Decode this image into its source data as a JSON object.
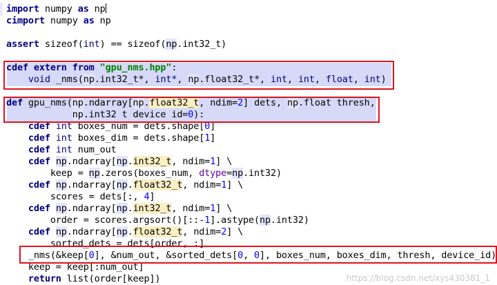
{
  "editor": {
    "language": "cython",
    "lines": [
      [
        [
          "kw",
          "import"
        ],
        [
          "txt",
          " numpy "
        ],
        [
          "kw",
          "as"
        ],
        [
          "txt",
          " np"
        ]
      ],
      [
        [
          "kw",
          "cimport"
        ],
        [
          "txt",
          " numpy "
        ],
        [
          "kw",
          "as"
        ],
        [
          "txt",
          " np"
        ]
      ],
      [],
      [
        [
          "kw",
          "assert"
        ],
        [
          "txt",
          " sizeof("
        ],
        [
          "ty",
          "int"
        ],
        [
          "txt",
          ") == sizeof("
        ],
        [
          "mod",
          "np"
        ],
        [
          "txt",
          ".int32_t)"
        ]
      ],
      [],
      [
        [
          "kw",
          "cdef extern from"
        ],
        [
          "txt",
          " "
        ],
        [
          "str",
          "\"gpu_nms.hpp\""
        ],
        [
          "txt",
          ":"
        ]
      ],
      [
        [
          "txt",
          "    "
        ],
        [
          "ty",
          "void"
        ],
        [
          "txt",
          " _nms("
        ],
        [
          "mod",
          "np"
        ],
        [
          "txt",
          "."
        ],
        [
          "txt",
          "int32_t*"
        ],
        [
          "txt",
          ", "
        ],
        [
          "ty",
          "int*"
        ],
        [
          "txt",
          ", "
        ],
        [
          "mod",
          "np"
        ],
        [
          "txt",
          ".float32_t*, "
        ],
        [
          "ty",
          "int"
        ],
        [
          "txt",
          ", "
        ],
        [
          "ty",
          "int"
        ],
        [
          "txt",
          ", "
        ],
        [
          "ty",
          "float"
        ],
        [
          "txt",
          ", "
        ],
        [
          "ty",
          "int"
        ],
        [
          "txt",
          ")"
        ]
      ],
      [],
      [
        [
          "kw",
          "def"
        ],
        [
          "txt",
          " gpu_nms("
        ],
        [
          "mod",
          "np"
        ],
        [
          "txt",
          ".ndarray["
        ],
        [
          "mod",
          "np"
        ],
        [
          "txt",
          "."
        ],
        [
          "attr",
          "float32_t"
        ],
        [
          "txt",
          ", ndim="
        ],
        [
          "num",
          "2"
        ],
        [
          "txt",
          "] dets, "
        ],
        [
          "mod",
          "np"
        ],
        [
          "txt",
          ".float thresh,"
        ]
      ],
      [
        [
          "txt",
          "            "
        ],
        [
          "mod",
          "np"
        ],
        [
          "txt",
          ".int32 t device id="
        ],
        [
          "num",
          "0"
        ],
        [
          "txt",
          "):"
        ]
      ],
      [
        [
          "txt",
          "    "
        ],
        [
          "kw",
          "cdef"
        ],
        [
          "txt",
          " "
        ],
        [
          "ty",
          "int"
        ],
        [
          "txt",
          " boxes_num = dets.shape["
        ],
        [
          "num",
          "0"
        ],
        [
          "txt",
          "]"
        ]
      ],
      [
        [
          "txt",
          "    "
        ],
        [
          "kw",
          "cdef"
        ],
        [
          "txt",
          " "
        ],
        [
          "ty",
          "int"
        ],
        [
          "txt",
          " boxes_dim = dets.shape["
        ],
        [
          "num",
          "1"
        ],
        [
          "txt",
          "]"
        ]
      ],
      [
        [
          "txt",
          "    "
        ],
        [
          "kw",
          "cdef"
        ],
        [
          "txt",
          " "
        ],
        [
          "ty",
          "int"
        ],
        [
          "txt",
          " num_out"
        ]
      ],
      [
        [
          "txt",
          "    "
        ],
        [
          "kw",
          "cdef"
        ],
        [
          "txt",
          " "
        ],
        [
          "mod",
          "np"
        ],
        [
          "txt",
          ".ndarray["
        ],
        [
          "mod",
          "np"
        ],
        [
          "txt",
          "."
        ],
        [
          "attr",
          "int32_t"
        ],
        [
          "txt",
          ", ndim="
        ],
        [
          "num",
          "1"
        ],
        [
          "txt",
          "] \\"
        ]
      ],
      [
        [
          "txt",
          "        keep = "
        ],
        [
          "mod",
          "np"
        ],
        [
          "txt",
          ".zeros(boxes_num, "
        ],
        [
          "kwarg",
          "dtype"
        ],
        [
          "txt",
          "="
        ],
        [
          "mod",
          "np"
        ],
        [
          "txt",
          ".int32)"
        ]
      ],
      [
        [
          "txt",
          "    "
        ],
        [
          "kw",
          "cdef"
        ],
        [
          "txt",
          " "
        ],
        [
          "mod",
          "np"
        ],
        [
          "txt",
          ".ndarray["
        ],
        [
          "mod",
          "np"
        ],
        [
          "txt",
          "."
        ],
        [
          "attr",
          "float32_t"
        ],
        [
          "txt",
          ", ndim="
        ],
        [
          "num",
          "1"
        ],
        [
          "txt",
          "] \\"
        ]
      ],
      [
        [
          "txt",
          "        scores = dets[:, "
        ],
        [
          "num",
          "4"
        ],
        [
          "txt",
          "]"
        ]
      ],
      [
        [
          "txt",
          "    "
        ],
        [
          "kw",
          "cdef"
        ],
        [
          "txt",
          " "
        ],
        [
          "mod",
          "np"
        ],
        [
          "txt",
          ".ndarray["
        ],
        [
          "mod",
          "np"
        ],
        [
          "txt",
          "."
        ],
        [
          "attr",
          "int32_t"
        ],
        [
          "txt",
          ", ndim="
        ],
        [
          "num",
          "1"
        ],
        [
          "txt",
          "] \\"
        ]
      ],
      [
        [
          "txt",
          "        order = scores.argsort()[::-"
        ],
        [
          "num",
          "1"
        ],
        [
          "txt",
          "].astype("
        ],
        [
          "mod",
          "np"
        ],
        [
          "txt",
          ".int32)"
        ]
      ],
      [
        [
          "txt",
          "    "
        ],
        [
          "kw",
          "cdef"
        ],
        [
          "txt",
          " "
        ],
        [
          "mod",
          "np"
        ],
        [
          "txt",
          ".ndarray["
        ],
        [
          "mod",
          "np"
        ],
        [
          "txt",
          "."
        ],
        [
          "attr",
          "float32_t"
        ],
        [
          "txt",
          ", ndim="
        ],
        [
          "num",
          "2"
        ],
        [
          "txt",
          "] \\"
        ]
      ],
      [
        [
          "txt",
          "        sorted_dets = dets[order, :]"
        ]
      ],
      [
        [
          "txt",
          "    _nms(&keep["
        ],
        [
          "num",
          "0"
        ],
        [
          "txt",
          "], &num_out, &sorted_dets["
        ],
        [
          "num",
          "0"
        ],
        [
          "txt",
          ", "
        ],
        [
          "num",
          "0"
        ],
        [
          "txt",
          "], boxes_num, boxes_dim, thresh, device_id)"
        ]
      ],
      [
        [
          "txt",
          "    keep = keep[:num_out]"
        ]
      ],
      [
        [
          "txt",
          "    "
        ],
        [
          "kw",
          "return"
        ],
        [
          "txt",
          " list(order[keep])"
        ]
      ]
    ]
  },
  "watermark": "https://blog.csdn.net/xys430381_1"
}
